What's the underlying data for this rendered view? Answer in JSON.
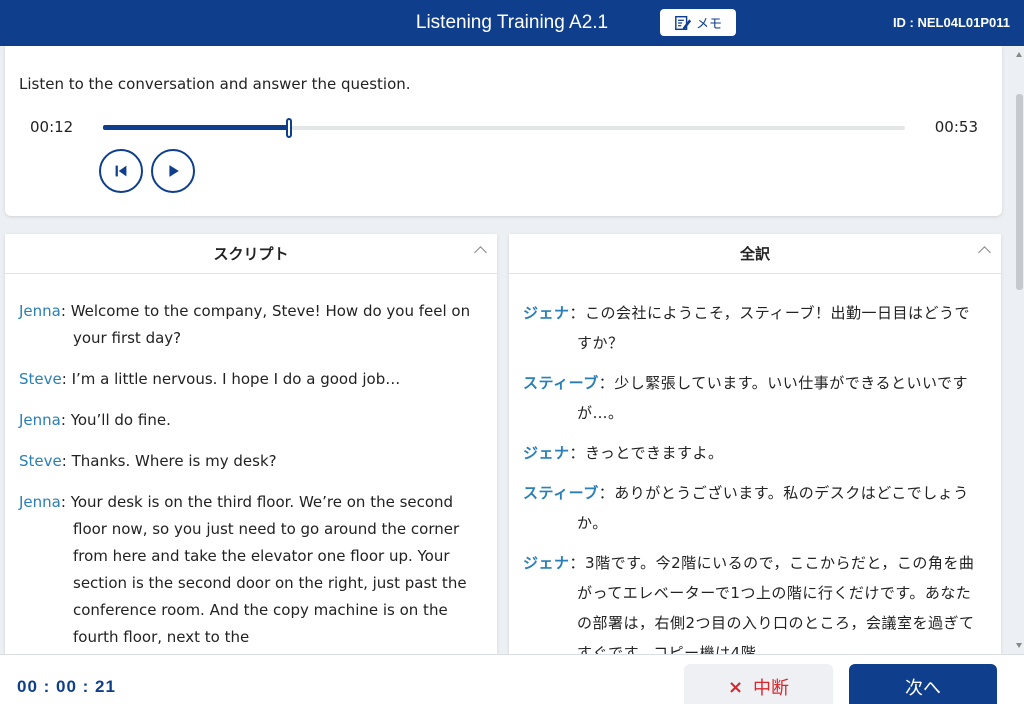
{
  "header": {
    "title": "Listening Training A2.1",
    "memo_label": "メモ",
    "id_text": "ID : NEL04L01P011"
  },
  "player": {
    "instruction": "Listen to the conversation and answer the question.",
    "current_time": "00:12",
    "total_time": "00:53",
    "progress": 0.232
  },
  "script_panel": {
    "title": "スクリプト",
    "lines": [
      {
        "speaker": "Jenna",
        "text": "Welcome to the company, Steve! How do you feel on your first day?"
      },
      {
        "speaker": "Steve",
        "text": "I’m a little nervous. I hope I do a good job…"
      },
      {
        "speaker": "Jenna",
        "text": "You’ll do fine."
      },
      {
        "speaker": "Steve",
        "text": "Thanks. Where is my desk?"
      },
      {
        "speaker": "Jenna",
        "text": "Your desk is on the third floor. We’re on the second floor now, so you just need to go around the corner from here and take the elevator one floor up. Your section is the second door on the right, just past the conference room. And the copy machine is on the fourth floor, next to the"
      }
    ]
  },
  "translation_panel": {
    "title": "全訳",
    "lines": [
      {
        "speaker": "ジェナ",
        "text": "この会社にようこそ，スティーブ！出勤一日目はどうですか？"
      },
      {
        "speaker": "スティーブ",
        "text": "少し緊張しています。いい仕事ができるといいですが…。"
      },
      {
        "speaker": "ジェナ",
        "text": "きっとできますよ。"
      },
      {
        "speaker": "スティーブ",
        "text": "ありがとうございます。私のデスクはどこでしょうか。"
      },
      {
        "speaker": "ジェナ",
        "text": "3階です。今2階にいるので，ここからだと，この角を曲がってエレベーターで1つ上の階に行くだけです。あなたの部署は，右側2つ目の入り口のところ，会議室を過ぎてすぐです。コピー機は4階"
      }
    ]
  },
  "footer": {
    "elapsed": "00 : 00 : 21",
    "stop_icon": "×",
    "stop_label": "中断",
    "next_label": "次へ"
  },
  "colors": {
    "brand": "#0f3f8c",
    "speaker": "#2a7fb6",
    "stop": "#d7262d"
  }
}
